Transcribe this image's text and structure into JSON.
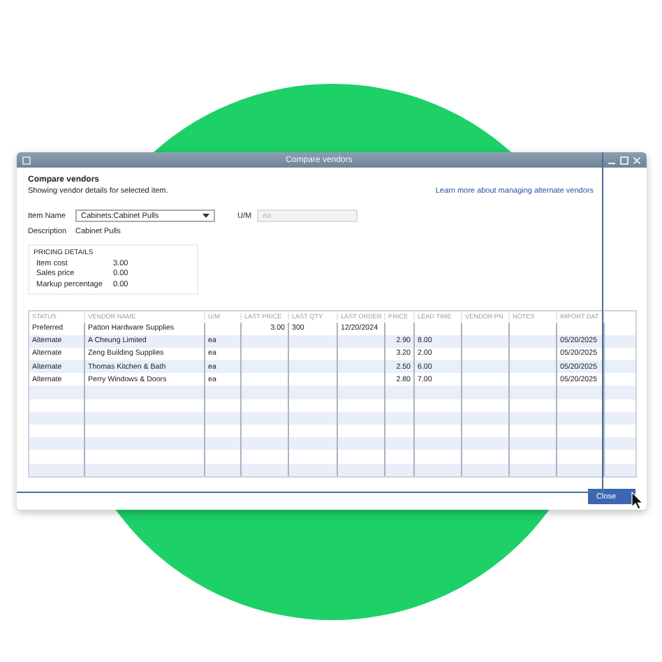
{
  "window": {
    "title": "Compare vendors"
  },
  "header": {
    "title": "Compare vendors",
    "subtitle": "Showing vendor details for selected item.",
    "help_link": "Learn more about managing alternate vendors"
  },
  "item": {
    "label": "Item Name",
    "value": "Cabinets:Cabinet Pulls",
    "um_label": "U/M",
    "um_value": "ea",
    "um_disabled": true,
    "description_label": "Description",
    "description": "Cabinet Pulls"
  },
  "pricing": {
    "title": "PRICING DETAILS",
    "rows": [
      {
        "label": "Item cost",
        "value": "3.00"
      },
      {
        "label": "Sales price",
        "value": "0.00"
      },
      {
        "label": "Markup percentage",
        "value": "0.00"
      }
    ]
  },
  "table": {
    "columns": [
      "STATUS",
      "VENDOR NAME",
      "U/M",
      "LAST PRICE",
      "LAST QTY",
      "LAST ORDER",
      "PRICE",
      "LEAD TIME",
      "VENDOR PN",
      "NOTES",
      "IMPORT DAT"
    ],
    "rows": [
      {
        "cells": [
          "Preferred",
          "Patton Hardware Supplies",
          "",
          "3.00",
          "300",
          "12/20/2024",
          "",
          "",
          "",
          "",
          ""
        ]
      },
      {
        "cells": [
          "Alternate",
          "A Cheung Limited",
          "ea",
          "",
          "",
          "",
          "2.90",
          "8.00",
          "",
          "",
          "05/20/2025"
        ]
      },
      {
        "cells": [
          "Alternate",
          "Zeng Building Supplies",
          "ea",
          "",
          "",
          "",
          "3.20",
          "2.00",
          "",
          "",
          "05/20/2025"
        ]
      },
      {
        "cells": [
          "Alternate",
          "Thomas Kitchen & Bath",
          "ea",
          "",
          "",
          "",
          "2.50",
          "6.00",
          "",
          "",
          "05/20/2025"
        ]
      },
      {
        "cells": [
          "Alternate",
          "Perry Windows & Doors",
          "ea",
          "",
          "",
          "",
          "2.80",
          "7.00",
          "",
          "",
          "05/20/2025"
        ]
      }
    ]
  },
  "buttons": [
    "Close"
  ]
}
